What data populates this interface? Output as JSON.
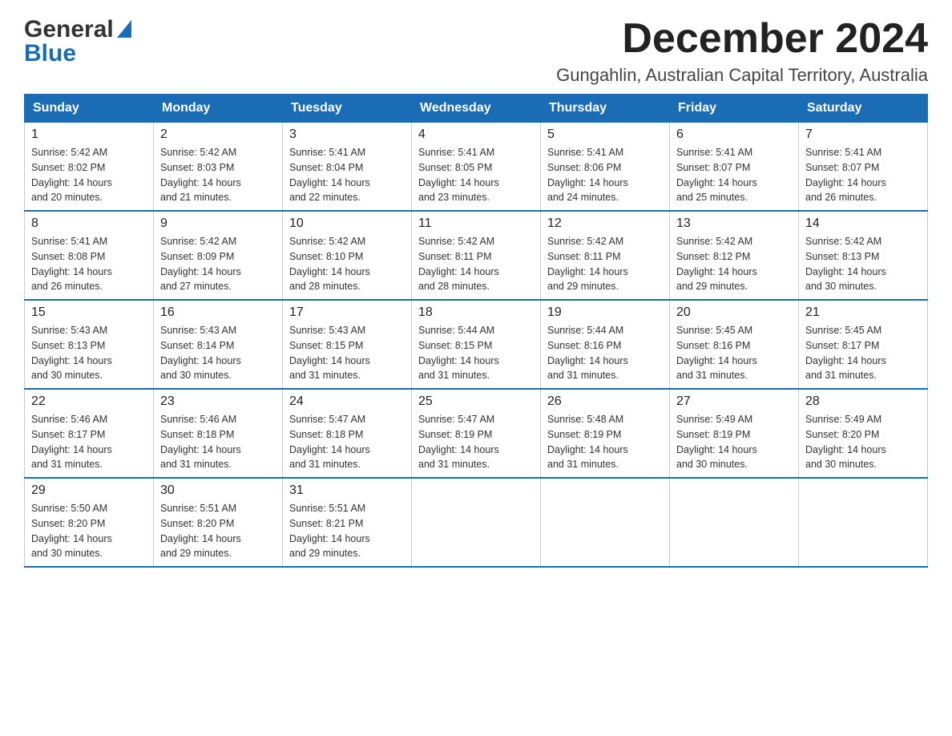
{
  "header": {
    "logo_general": "General",
    "logo_blue": "Blue",
    "month_title": "December 2024",
    "location": "Gungahlin, Australian Capital Territory, Australia"
  },
  "days_of_week": [
    "Sunday",
    "Monday",
    "Tuesday",
    "Wednesday",
    "Thursday",
    "Friday",
    "Saturday"
  ],
  "weeks": [
    [
      {
        "day": "1",
        "sunrise": "5:42 AM",
        "sunset": "8:02 PM",
        "daylight": "14 hours and 20 minutes."
      },
      {
        "day": "2",
        "sunrise": "5:42 AM",
        "sunset": "8:03 PM",
        "daylight": "14 hours and 21 minutes."
      },
      {
        "day": "3",
        "sunrise": "5:41 AM",
        "sunset": "8:04 PM",
        "daylight": "14 hours and 22 minutes."
      },
      {
        "day": "4",
        "sunrise": "5:41 AM",
        "sunset": "8:05 PM",
        "daylight": "14 hours and 23 minutes."
      },
      {
        "day": "5",
        "sunrise": "5:41 AM",
        "sunset": "8:06 PM",
        "daylight": "14 hours and 24 minutes."
      },
      {
        "day": "6",
        "sunrise": "5:41 AM",
        "sunset": "8:07 PM",
        "daylight": "14 hours and 25 minutes."
      },
      {
        "day": "7",
        "sunrise": "5:41 AM",
        "sunset": "8:07 PM",
        "daylight": "14 hours and 26 minutes."
      }
    ],
    [
      {
        "day": "8",
        "sunrise": "5:41 AM",
        "sunset": "8:08 PM",
        "daylight": "14 hours and 26 minutes."
      },
      {
        "day": "9",
        "sunrise": "5:42 AM",
        "sunset": "8:09 PM",
        "daylight": "14 hours and 27 minutes."
      },
      {
        "day": "10",
        "sunrise": "5:42 AM",
        "sunset": "8:10 PM",
        "daylight": "14 hours and 28 minutes."
      },
      {
        "day": "11",
        "sunrise": "5:42 AM",
        "sunset": "8:11 PM",
        "daylight": "14 hours and 28 minutes."
      },
      {
        "day": "12",
        "sunrise": "5:42 AM",
        "sunset": "8:11 PM",
        "daylight": "14 hours and 29 minutes."
      },
      {
        "day": "13",
        "sunrise": "5:42 AM",
        "sunset": "8:12 PM",
        "daylight": "14 hours and 29 minutes."
      },
      {
        "day": "14",
        "sunrise": "5:42 AM",
        "sunset": "8:13 PM",
        "daylight": "14 hours and 30 minutes."
      }
    ],
    [
      {
        "day": "15",
        "sunrise": "5:43 AM",
        "sunset": "8:13 PM",
        "daylight": "14 hours and 30 minutes."
      },
      {
        "day": "16",
        "sunrise": "5:43 AM",
        "sunset": "8:14 PM",
        "daylight": "14 hours and 30 minutes."
      },
      {
        "day": "17",
        "sunrise": "5:43 AM",
        "sunset": "8:15 PM",
        "daylight": "14 hours and 31 minutes."
      },
      {
        "day": "18",
        "sunrise": "5:44 AM",
        "sunset": "8:15 PM",
        "daylight": "14 hours and 31 minutes."
      },
      {
        "day": "19",
        "sunrise": "5:44 AM",
        "sunset": "8:16 PM",
        "daylight": "14 hours and 31 minutes."
      },
      {
        "day": "20",
        "sunrise": "5:45 AM",
        "sunset": "8:16 PM",
        "daylight": "14 hours and 31 minutes."
      },
      {
        "day": "21",
        "sunrise": "5:45 AM",
        "sunset": "8:17 PM",
        "daylight": "14 hours and 31 minutes."
      }
    ],
    [
      {
        "day": "22",
        "sunrise": "5:46 AM",
        "sunset": "8:17 PM",
        "daylight": "14 hours and 31 minutes."
      },
      {
        "day": "23",
        "sunrise": "5:46 AM",
        "sunset": "8:18 PM",
        "daylight": "14 hours and 31 minutes."
      },
      {
        "day": "24",
        "sunrise": "5:47 AM",
        "sunset": "8:18 PM",
        "daylight": "14 hours and 31 minutes."
      },
      {
        "day": "25",
        "sunrise": "5:47 AM",
        "sunset": "8:19 PM",
        "daylight": "14 hours and 31 minutes."
      },
      {
        "day": "26",
        "sunrise": "5:48 AM",
        "sunset": "8:19 PM",
        "daylight": "14 hours and 31 minutes."
      },
      {
        "day": "27",
        "sunrise": "5:49 AM",
        "sunset": "8:19 PM",
        "daylight": "14 hours and 30 minutes."
      },
      {
        "day": "28",
        "sunrise": "5:49 AM",
        "sunset": "8:20 PM",
        "daylight": "14 hours and 30 minutes."
      }
    ],
    [
      {
        "day": "29",
        "sunrise": "5:50 AM",
        "sunset": "8:20 PM",
        "daylight": "14 hours and 30 minutes."
      },
      {
        "day": "30",
        "sunrise": "5:51 AM",
        "sunset": "8:20 PM",
        "daylight": "14 hours and 29 minutes."
      },
      {
        "day": "31",
        "sunrise": "5:51 AM",
        "sunset": "8:21 PM",
        "daylight": "14 hours and 29 minutes."
      },
      null,
      null,
      null,
      null
    ]
  ],
  "labels": {
    "sunrise": "Sunrise:",
    "sunset": "Sunset:",
    "daylight": "Daylight:"
  }
}
